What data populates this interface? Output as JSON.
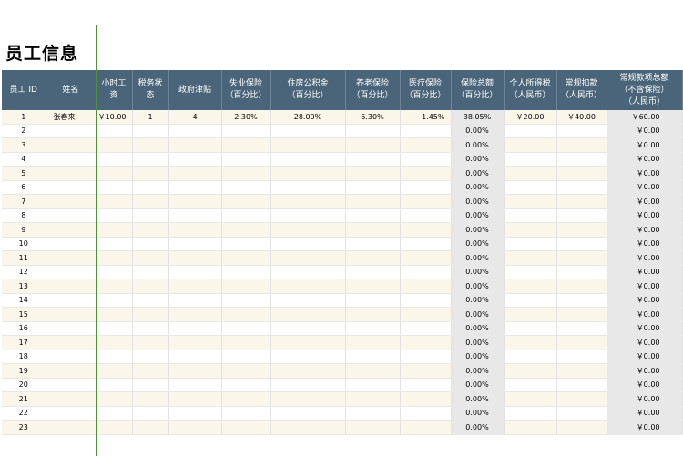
{
  "title": "员工信息",
  "headers": [
    {
      "line1": "员工 ID",
      "line2": "",
      "line3": ""
    },
    {
      "line1": "姓名",
      "line2": "",
      "line3": ""
    },
    {
      "line1": "小时工",
      "line2": "资",
      "line3": ""
    },
    {
      "line1": "税务状",
      "line2": "态",
      "line3": ""
    },
    {
      "line1": "政府津贴",
      "line2": "",
      "line3": ""
    },
    {
      "line1": "失业保险",
      "line2": "（百分比）",
      "line3": ""
    },
    {
      "line1": "住房公积金",
      "line2": "（百分比）",
      "line3": ""
    },
    {
      "line1": "养老保险",
      "line2": "（百分比）",
      "line3": ""
    },
    {
      "line1": "医疗保险",
      "line2": "（百分比）",
      "line3": ""
    },
    {
      "line1": "保险总额",
      "line2": "（百分比）",
      "line3": ""
    },
    {
      "line1": "个人所得税",
      "line2": "（人民币）",
      "line3": ""
    },
    {
      "line1": "常规扣款",
      "line2": "（人民币）",
      "line3": ""
    },
    {
      "line1": "常规款项总额",
      "line2": "（不含保险）",
      "line3": "（人民币）"
    }
  ],
  "rows": [
    {
      "id": "1",
      "name": "张春来",
      "wage": "￥10.00",
      "tax_status": "1",
      "allowance": "4",
      "unemployment": "2.30%",
      "housing": "28.00%",
      "pension": "6.30%",
      "medical": "1.45%",
      "ins_total": "38.05%",
      "income_tax": "￥20.00",
      "deduction": "￥40.00",
      "total": "￥60.00"
    },
    {
      "id": "2",
      "name": "",
      "wage": "",
      "tax_status": "",
      "allowance": "",
      "unemployment": "",
      "housing": "",
      "pension": "",
      "medical": "",
      "ins_total": "0.00%",
      "income_tax": "",
      "deduction": "",
      "total": "￥0.00"
    },
    {
      "id": "3",
      "name": "",
      "wage": "",
      "tax_status": "",
      "allowance": "",
      "unemployment": "",
      "housing": "",
      "pension": "",
      "medical": "",
      "ins_total": "0.00%",
      "income_tax": "",
      "deduction": "",
      "total": "￥0.00"
    },
    {
      "id": "4",
      "name": "",
      "wage": "",
      "tax_status": "",
      "allowance": "",
      "unemployment": "",
      "housing": "",
      "pension": "",
      "medical": "",
      "ins_total": "0.00%",
      "income_tax": "",
      "deduction": "",
      "total": "￥0.00"
    },
    {
      "id": "5",
      "name": "",
      "wage": "",
      "tax_status": "",
      "allowance": "",
      "unemployment": "",
      "housing": "",
      "pension": "",
      "medical": "",
      "ins_total": "0.00%",
      "income_tax": "",
      "deduction": "",
      "total": "￥0.00"
    },
    {
      "id": "6",
      "name": "",
      "wage": "",
      "tax_status": "",
      "allowance": "",
      "unemployment": "",
      "housing": "",
      "pension": "",
      "medical": "",
      "ins_total": "0.00%",
      "income_tax": "",
      "deduction": "",
      "total": "￥0.00"
    },
    {
      "id": "7",
      "name": "",
      "wage": "",
      "tax_status": "",
      "allowance": "",
      "unemployment": "",
      "housing": "",
      "pension": "",
      "medical": "",
      "ins_total": "0.00%",
      "income_tax": "",
      "deduction": "",
      "total": "￥0.00"
    },
    {
      "id": "8",
      "name": "",
      "wage": "",
      "tax_status": "",
      "allowance": "",
      "unemployment": "",
      "housing": "",
      "pension": "",
      "medical": "",
      "ins_total": "0.00%",
      "income_tax": "",
      "deduction": "",
      "total": "￥0.00"
    },
    {
      "id": "9",
      "name": "",
      "wage": "",
      "tax_status": "",
      "allowance": "",
      "unemployment": "",
      "housing": "",
      "pension": "",
      "medical": "",
      "ins_total": "0.00%",
      "income_tax": "",
      "deduction": "",
      "total": "￥0.00"
    },
    {
      "id": "10",
      "name": "",
      "wage": "",
      "tax_status": "",
      "allowance": "",
      "unemployment": "",
      "housing": "",
      "pension": "",
      "medical": "",
      "ins_total": "0.00%",
      "income_tax": "",
      "deduction": "",
      "total": "￥0.00"
    },
    {
      "id": "11",
      "name": "",
      "wage": "",
      "tax_status": "",
      "allowance": "",
      "unemployment": "",
      "housing": "",
      "pension": "",
      "medical": "",
      "ins_total": "0.00%",
      "income_tax": "",
      "deduction": "",
      "total": "￥0.00"
    },
    {
      "id": "12",
      "name": "",
      "wage": "",
      "tax_status": "",
      "allowance": "",
      "unemployment": "",
      "housing": "",
      "pension": "",
      "medical": "",
      "ins_total": "0.00%",
      "income_tax": "",
      "deduction": "",
      "total": "￥0.00"
    },
    {
      "id": "13",
      "name": "",
      "wage": "",
      "tax_status": "",
      "allowance": "",
      "unemployment": "",
      "housing": "",
      "pension": "",
      "medical": "",
      "ins_total": "0.00%",
      "income_tax": "",
      "deduction": "",
      "total": "￥0.00"
    },
    {
      "id": "14",
      "name": "",
      "wage": "",
      "tax_status": "",
      "allowance": "",
      "unemployment": "",
      "housing": "",
      "pension": "",
      "medical": "",
      "ins_total": "0.00%",
      "income_tax": "",
      "deduction": "",
      "total": "￥0.00"
    },
    {
      "id": "15",
      "name": "",
      "wage": "",
      "tax_status": "",
      "allowance": "",
      "unemployment": "",
      "housing": "",
      "pension": "",
      "medical": "",
      "ins_total": "0.00%",
      "income_tax": "",
      "deduction": "",
      "total": "￥0.00"
    },
    {
      "id": "16",
      "name": "",
      "wage": "",
      "tax_status": "",
      "allowance": "",
      "unemployment": "",
      "housing": "",
      "pension": "",
      "medical": "",
      "ins_total": "0.00%",
      "income_tax": "",
      "deduction": "",
      "total": "￥0.00"
    },
    {
      "id": "17",
      "name": "",
      "wage": "",
      "tax_status": "",
      "allowance": "",
      "unemployment": "",
      "housing": "",
      "pension": "",
      "medical": "",
      "ins_total": "0.00%",
      "income_tax": "",
      "deduction": "",
      "total": "￥0.00"
    },
    {
      "id": "18",
      "name": "",
      "wage": "",
      "tax_status": "",
      "allowance": "",
      "unemployment": "",
      "housing": "",
      "pension": "",
      "medical": "",
      "ins_total": "0.00%",
      "income_tax": "",
      "deduction": "",
      "total": "￥0.00"
    },
    {
      "id": "19",
      "name": "",
      "wage": "",
      "tax_status": "",
      "allowance": "",
      "unemployment": "",
      "housing": "",
      "pension": "",
      "medical": "",
      "ins_total": "0.00%",
      "income_tax": "",
      "deduction": "",
      "total": "￥0.00"
    },
    {
      "id": "20",
      "name": "",
      "wage": "",
      "tax_status": "",
      "allowance": "",
      "unemployment": "",
      "housing": "",
      "pension": "",
      "medical": "",
      "ins_total": "0.00%",
      "income_tax": "",
      "deduction": "",
      "total": "￥0.00"
    },
    {
      "id": "21",
      "name": "",
      "wage": "",
      "tax_status": "",
      "allowance": "",
      "unemployment": "",
      "housing": "",
      "pension": "",
      "medical": "",
      "ins_total": "0.00%",
      "income_tax": "",
      "deduction": "",
      "total": "￥0.00"
    },
    {
      "id": "22",
      "name": "",
      "wage": "",
      "tax_status": "",
      "allowance": "",
      "unemployment": "",
      "housing": "",
      "pension": "",
      "medical": "",
      "ins_total": "0.00%",
      "income_tax": "",
      "deduction": "",
      "total": "￥0.00"
    },
    {
      "id": "23",
      "name": "",
      "wage": "",
      "tax_status": "",
      "allowance": "",
      "unemployment": "",
      "housing": "",
      "pension": "",
      "medical": "",
      "ins_total": "0.00%",
      "income_tax": "",
      "deduction": "",
      "total": "￥0.00"
    }
  ],
  "colors": {
    "header_bg": "#4a6579",
    "header_text": "#ffffff",
    "row_alt": "#faf7ea",
    "calc_cell": "#e8e8e8",
    "freeze_line": "#4f8f3f"
  }
}
